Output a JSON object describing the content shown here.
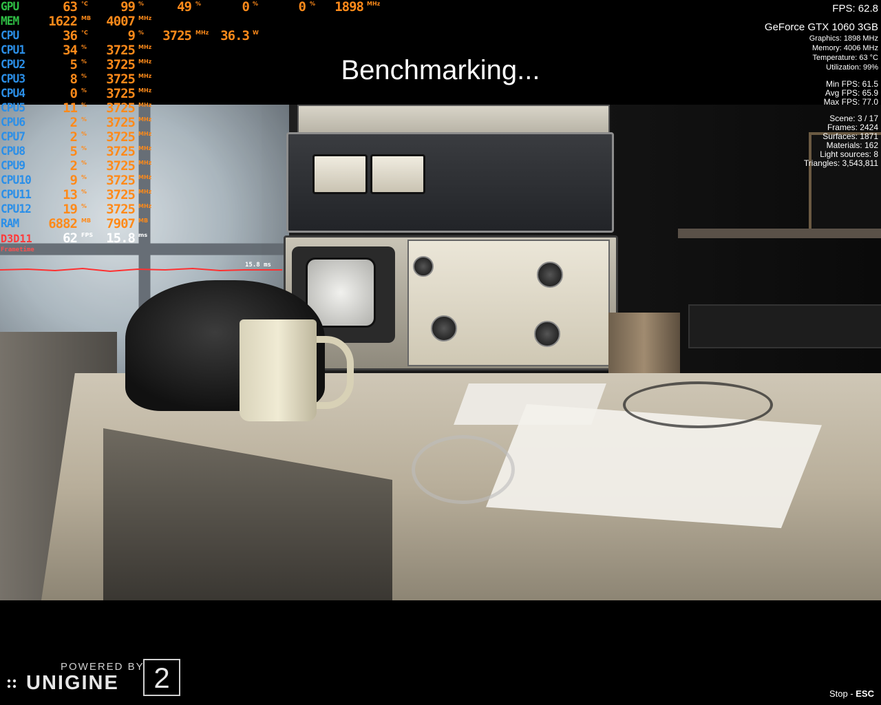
{
  "benchmark": {
    "title": "Benchmarking..."
  },
  "osd": {
    "rows": [
      {
        "label": "GPU",
        "values": [
          {
            "v": "63",
            "u": "°C"
          },
          {
            "v": "99",
            "u": "%"
          },
          {
            "v": "49",
            "u": "%"
          },
          {
            "v": "0",
            "u": "%"
          },
          {
            "v": "0",
            "u": "%"
          },
          {
            "v": "1898",
            "u": "MHz"
          }
        ]
      },
      {
        "label": "MEM",
        "values": [
          {
            "v": "1622",
            "u": "MB"
          },
          {
            "v": "4007",
            "u": "MHz"
          }
        ]
      },
      {
        "label": "CPU",
        "values": [
          {
            "v": "36",
            "u": "°C"
          },
          {
            "v": "9",
            "u": "%"
          },
          {
            "v": "3725",
            "u": "MHz"
          },
          {
            "v": "36.3",
            "u": "W"
          }
        ]
      },
      {
        "label": "CPU1",
        "values": [
          {
            "v": "34",
            "u": "%"
          },
          {
            "v": "3725",
            "u": "MHz"
          }
        ]
      },
      {
        "label": "CPU2",
        "values": [
          {
            "v": "5",
            "u": "%"
          },
          {
            "v": "3725",
            "u": "MHz"
          }
        ]
      },
      {
        "label": "CPU3",
        "values": [
          {
            "v": "8",
            "u": "%"
          },
          {
            "v": "3725",
            "u": "MHz"
          }
        ]
      },
      {
        "label": "CPU4",
        "values": [
          {
            "v": "0",
            "u": "%"
          },
          {
            "v": "3725",
            "u": "MHz"
          }
        ]
      },
      {
        "label": "CPU5",
        "values": [
          {
            "v": "11",
            "u": "%"
          },
          {
            "v": "3725",
            "u": "MHz"
          }
        ]
      },
      {
        "label": "CPU6",
        "values": [
          {
            "v": "2",
            "u": "%"
          },
          {
            "v": "3725",
            "u": "MHz"
          }
        ]
      },
      {
        "label": "CPU7",
        "values": [
          {
            "v": "2",
            "u": "%"
          },
          {
            "v": "3725",
            "u": "MHz"
          }
        ]
      },
      {
        "label": "CPU8",
        "values": [
          {
            "v": "5",
            "u": "%"
          },
          {
            "v": "3725",
            "u": "MHz"
          }
        ]
      },
      {
        "label": "CPU9",
        "values": [
          {
            "v": "2",
            "u": "%"
          },
          {
            "v": "3725",
            "u": "MHz"
          }
        ]
      },
      {
        "label": "CPU10",
        "values": [
          {
            "v": "9",
            "u": "%"
          },
          {
            "v": "3725",
            "u": "MHz"
          }
        ]
      },
      {
        "label": "CPU11",
        "values": [
          {
            "v": "13",
            "u": "%"
          },
          {
            "v": "3725",
            "u": "MHz"
          }
        ]
      },
      {
        "label": "CPU12",
        "values": [
          {
            "v": "19",
            "u": "%"
          },
          {
            "v": "3725",
            "u": "MHz"
          }
        ]
      },
      {
        "label": "RAM",
        "values": [
          {
            "v": "6882",
            "u": "MB"
          },
          {
            "v": "7907",
            "u": "MB"
          }
        ]
      },
      {
        "label": "D3D11",
        "values": [
          {
            "v": "62",
            "u": "FPS"
          },
          {
            "v": "15.8",
            "u": "ms"
          }
        ]
      }
    ],
    "frametime_label": "Frametime",
    "frametime_value": "15.8 ms"
  },
  "stats": {
    "fps": "FPS: 62.8",
    "gpu_name": "GeForce GTX 1060 3GB",
    "graphics": "Graphics: 1898 MHz",
    "memory": "Memory: 4006 MHz",
    "temperature": "Temperature: 63 °C",
    "utilization": "Utilization:  99%",
    "min_fps": "Min FPS: 61.5",
    "avg_fps": "Avg FPS: 65.9",
    "max_fps": "Max FPS: 77.0",
    "scene": "Scene: 3 / 17",
    "frames": "Frames: 2424",
    "surfaces": "Surfaces: 1871",
    "materials": "Materials: 162",
    "light_sources": "Light sources: 8",
    "triangles": "Triangles: 3,543,811"
  },
  "footer": {
    "powered_by": "POWERED BY",
    "brand": "UNIGINE",
    "version": "2",
    "stop_label": "Stop - ",
    "stop_key": "ESC"
  },
  "colors": {
    "value_orange": "#ff8a1a",
    "label_green": "#2fbf45",
    "label_blue": "#2b8fe8",
    "label_red": "#ff3a3a"
  }
}
